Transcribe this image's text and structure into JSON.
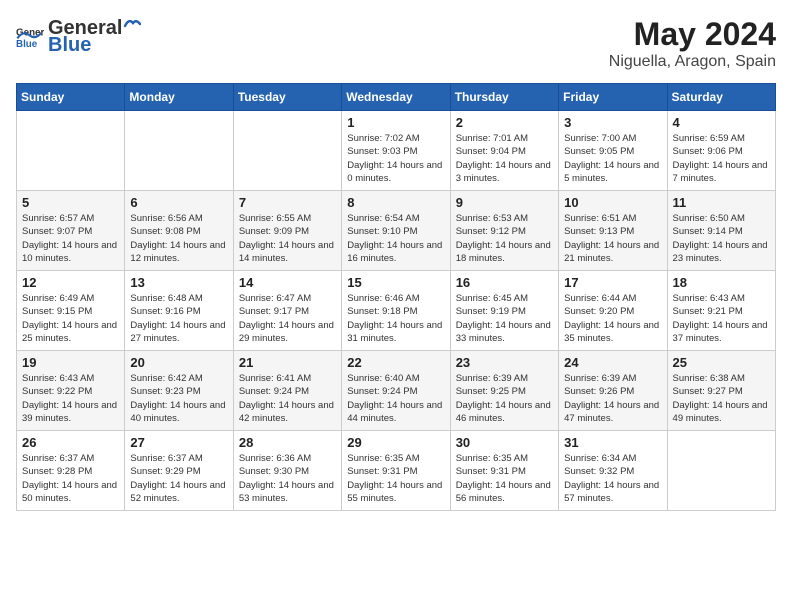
{
  "header": {
    "logo_general": "General",
    "logo_blue": "Blue",
    "month_year": "May 2024",
    "location": "Niguella, Aragon, Spain"
  },
  "weekdays": [
    "Sunday",
    "Monday",
    "Tuesday",
    "Wednesday",
    "Thursday",
    "Friday",
    "Saturday"
  ],
  "weeks": [
    [
      {
        "day": "",
        "sunrise": "",
        "sunset": "",
        "daylight": ""
      },
      {
        "day": "",
        "sunrise": "",
        "sunset": "",
        "daylight": ""
      },
      {
        "day": "",
        "sunrise": "",
        "sunset": "",
        "daylight": ""
      },
      {
        "day": "1",
        "sunrise": "Sunrise: 7:02 AM",
        "sunset": "Sunset: 9:03 PM",
        "daylight": "Daylight: 14 hours and 0 minutes."
      },
      {
        "day": "2",
        "sunrise": "Sunrise: 7:01 AM",
        "sunset": "Sunset: 9:04 PM",
        "daylight": "Daylight: 14 hours and 3 minutes."
      },
      {
        "day": "3",
        "sunrise": "Sunrise: 7:00 AM",
        "sunset": "Sunset: 9:05 PM",
        "daylight": "Daylight: 14 hours and 5 minutes."
      },
      {
        "day": "4",
        "sunrise": "Sunrise: 6:59 AM",
        "sunset": "Sunset: 9:06 PM",
        "daylight": "Daylight: 14 hours and 7 minutes."
      }
    ],
    [
      {
        "day": "5",
        "sunrise": "Sunrise: 6:57 AM",
        "sunset": "Sunset: 9:07 PM",
        "daylight": "Daylight: 14 hours and 10 minutes."
      },
      {
        "day": "6",
        "sunrise": "Sunrise: 6:56 AM",
        "sunset": "Sunset: 9:08 PM",
        "daylight": "Daylight: 14 hours and 12 minutes."
      },
      {
        "day": "7",
        "sunrise": "Sunrise: 6:55 AM",
        "sunset": "Sunset: 9:09 PM",
        "daylight": "Daylight: 14 hours and 14 minutes."
      },
      {
        "day": "8",
        "sunrise": "Sunrise: 6:54 AM",
        "sunset": "Sunset: 9:10 PM",
        "daylight": "Daylight: 14 hours and 16 minutes."
      },
      {
        "day": "9",
        "sunrise": "Sunrise: 6:53 AM",
        "sunset": "Sunset: 9:12 PM",
        "daylight": "Daylight: 14 hours and 18 minutes."
      },
      {
        "day": "10",
        "sunrise": "Sunrise: 6:51 AM",
        "sunset": "Sunset: 9:13 PM",
        "daylight": "Daylight: 14 hours and 21 minutes."
      },
      {
        "day": "11",
        "sunrise": "Sunrise: 6:50 AM",
        "sunset": "Sunset: 9:14 PM",
        "daylight": "Daylight: 14 hours and 23 minutes."
      }
    ],
    [
      {
        "day": "12",
        "sunrise": "Sunrise: 6:49 AM",
        "sunset": "Sunset: 9:15 PM",
        "daylight": "Daylight: 14 hours and 25 minutes."
      },
      {
        "day": "13",
        "sunrise": "Sunrise: 6:48 AM",
        "sunset": "Sunset: 9:16 PM",
        "daylight": "Daylight: 14 hours and 27 minutes."
      },
      {
        "day": "14",
        "sunrise": "Sunrise: 6:47 AM",
        "sunset": "Sunset: 9:17 PM",
        "daylight": "Daylight: 14 hours and 29 minutes."
      },
      {
        "day": "15",
        "sunrise": "Sunrise: 6:46 AM",
        "sunset": "Sunset: 9:18 PM",
        "daylight": "Daylight: 14 hours and 31 minutes."
      },
      {
        "day": "16",
        "sunrise": "Sunrise: 6:45 AM",
        "sunset": "Sunset: 9:19 PM",
        "daylight": "Daylight: 14 hours and 33 minutes."
      },
      {
        "day": "17",
        "sunrise": "Sunrise: 6:44 AM",
        "sunset": "Sunset: 9:20 PM",
        "daylight": "Daylight: 14 hours and 35 minutes."
      },
      {
        "day": "18",
        "sunrise": "Sunrise: 6:43 AM",
        "sunset": "Sunset: 9:21 PM",
        "daylight": "Daylight: 14 hours and 37 minutes."
      }
    ],
    [
      {
        "day": "19",
        "sunrise": "Sunrise: 6:43 AM",
        "sunset": "Sunset: 9:22 PM",
        "daylight": "Daylight: 14 hours and 39 minutes."
      },
      {
        "day": "20",
        "sunrise": "Sunrise: 6:42 AM",
        "sunset": "Sunset: 9:23 PM",
        "daylight": "Daylight: 14 hours and 40 minutes."
      },
      {
        "day": "21",
        "sunrise": "Sunrise: 6:41 AM",
        "sunset": "Sunset: 9:24 PM",
        "daylight": "Daylight: 14 hours and 42 minutes."
      },
      {
        "day": "22",
        "sunrise": "Sunrise: 6:40 AM",
        "sunset": "Sunset: 9:24 PM",
        "daylight": "Daylight: 14 hours and 44 minutes."
      },
      {
        "day": "23",
        "sunrise": "Sunrise: 6:39 AM",
        "sunset": "Sunset: 9:25 PM",
        "daylight": "Daylight: 14 hours and 46 minutes."
      },
      {
        "day": "24",
        "sunrise": "Sunrise: 6:39 AM",
        "sunset": "Sunset: 9:26 PM",
        "daylight": "Daylight: 14 hours and 47 minutes."
      },
      {
        "day": "25",
        "sunrise": "Sunrise: 6:38 AM",
        "sunset": "Sunset: 9:27 PM",
        "daylight": "Daylight: 14 hours and 49 minutes."
      }
    ],
    [
      {
        "day": "26",
        "sunrise": "Sunrise: 6:37 AM",
        "sunset": "Sunset: 9:28 PM",
        "daylight": "Daylight: 14 hours and 50 minutes."
      },
      {
        "day": "27",
        "sunrise": "Sunrise: 6:37 AM",
        "sunset": "Sunset: 9:29 PM",
        "daylight": "Daylight: 14 hours and 52 minutes."
      },
      {
        "day": "28",
        "sunrise": "Sunrise: 6:36 AM",
        "sunset": "Sunset: 9:30 PM",
        "daylight": "Daylight: 14 hours and 53 minutes."
      },
      {
        "day": "29",
        "sunrise": "Sunrise: 6:35 AM",
        "sunset": "Sunset: 9:31 PM",
        "daylight": "Daylight: 14 hours and 55 minutes."
      },
      {
        "day": "30",
        "sunrise": "Sunrise: 6:35 AM",
        "sunset": "Sunset: 9:31 PM",
        "daylight": "Daylight: 14 hours and 56 minutes."
      },
      {
        "day": "31",
        "sunrise": "Sunrise: 6:34 AM",
        "sunset": "Sunset: 9:32 PM",
        "daylight": "Daylight: 14 hours and 57 minutes."
      },
      {
        "day": "",
        "sunrise": "",
        "sunset": "",
        "daylight": ""
      }
    ]
  ]
}
